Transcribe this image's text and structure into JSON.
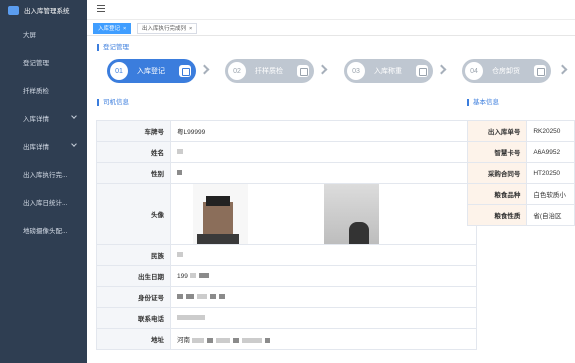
{
  "app": {
    "title": "出入库管理系统"
  },
  "sidebar": {
    "items": [
      {
        "label": "大屏"
      },
      {
        "label": "登记管理"
      },
      {
        "label": "扦样质检"
      },
      {
        "label": "入库详情"
      },
      {
        "label": "出库详情"
      },
      {
        "label": "出入库执行完..."
      },
      {
        "label": "出入库日统计..."
      },
      {
        "label": "地磅摄像头配..."
      }
    ]
  },
  "tabs": [
    {
      "label": "入库登记",
      "close": "×"
    },
    {
      "label": "出入库执行完成列",
      "close": "×"
    }
  ],
  "registration": {
    "title": "登记管理",
    "steps": [
      {
        "num": "01",
        "label": "入库登记",
        "icon": "document-icon"
      },
      {
        "num": "02",
        "label": "扦样质检",
        "icon": "flask-icon"
      },
      {
        "num": "03",
        "label": "入库称重",
        "icon": "scale-icon"
      },
      {
        "num": "04",
        "label": "仓房卸货",
        "icon": "warehouse-icon"
      }
    ]
  },
  "driver": {
    "title": "司机信息",
    "rows": [
      {
        "key": "车牌号",
        "value": "粤L99999"
      },
      {
        "key": "姓名",
        "value": ""
      },
      {
        "key": "性别",
        "value": ""
      },
      {
        "key": "头像",
        "value": ""
      },
      {
        "key": "民族",
        "value": ""
      },
      {
        "key": "出生日期",
        "value": "199"
      },
      {
        "key": "身份证号",
        "value": ""
      },
      {
        "key": "联系电话",
        "value": ""
      },
      {
        "key": "地址",
        "value": "河南"
      }
    ]
  },
  "basic": {
    "title": "基本信息",
    "rows": [
      {
        "key": "出入库单号",
        "value": "RK20250"
      },
      {
        "key": "智慧卡号",
        "value": "A6A9952"
      },
      {
        "key": "采购合同号",
        "value": "HT20250"
      },
      {
        "key": "粮食品种",
        "value": "白色软质小"
      },
      {
        "key": "粮食性质",
        "value": "省(自治区"
      }
    ]
  },
  "colors": {
    "sidebar": "#2f3e52",
    "accent": "#3b7ddd",
    "tab_active": "#409eff"
  }
}
